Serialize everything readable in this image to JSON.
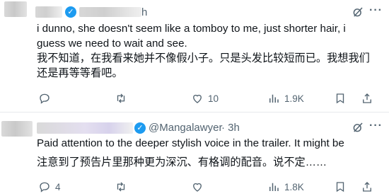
{
  "tweet1": {
    "handle_suffix": "h",
    "text_en": "i dunno, she doesn't seem like a tomboy to me, just shorter hair, i guess we need to wait and see.",
    "text_zh": "我不知道，在我看来她并不像假小子。只是头发比较短而已。我想我们还是再等等看吧。",
    "actions": {
      "reply": "",
      "retweet": "",
      "like": "10",
      "views": "1.9K"
    }
  },
  "tweet2": {
    "handle": "@Mangalawyer",
    "time": "· 3h",
    "text_en": "Paid attention to the deeper stylish voice in the trailer. It might be",
    "text_zh": "注意到了预告片里那种更为深沉、有格调的配音。说不定……",
    "actions": {
      "reply": "4",
      "retweet": "",
      "like": "",
      "views": "1.8K"
    }
  },
  "colors": {
    "accent": "#1d9bf0",
    "muted": "#536471",
    "text": "#0f1419",
    "divider": "#e6e9ec"
  },
  "icons": [
    "verified-badge-icon",
    "grok-icon",
    "more-icon",
    "reply-icon",
    "retweet-icon",
    "like-icon",
    "views-icon",
    "bookmark-icon",
    "share-icon"
  ]
}
